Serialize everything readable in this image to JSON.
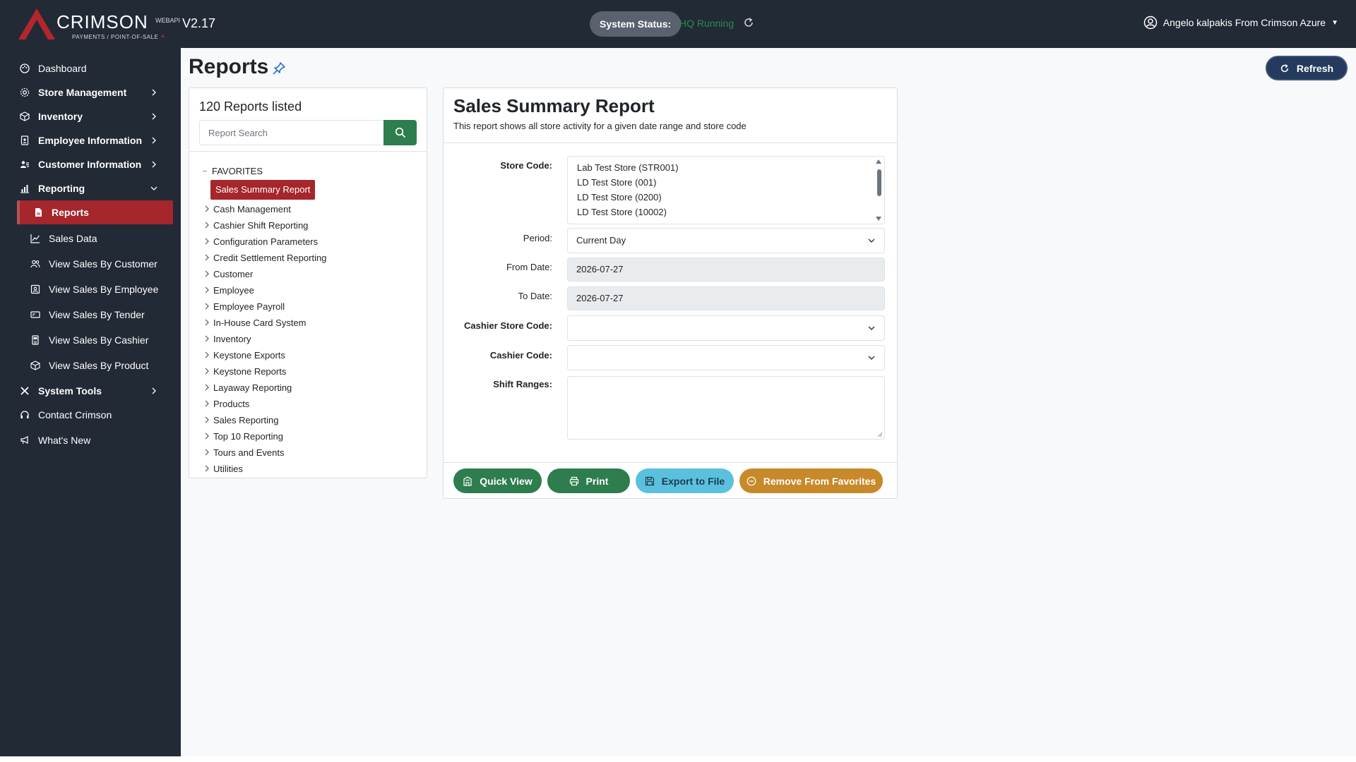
{
  "header": {
    "logo_word": "CRIMSON",
    "logo_tagline": "PAYMENTS / POINT-OF-SALE",
    "logo_plus": "+",
    "logo_badge": "WEBAPI",
    "version": "V2.17",
    "status_label": "System Status:",
    "status_value": "HQ Running",
    "user": "Angelo kalpakis  From Crimson Azure",
    "colors": {
      "bar": "#222a36",
      "status_ok": "#2c8a4f"
    }
  },
  "sidebar": {
    "items": [
      {
        "label": "Dashboard",
        "icon": "palette-icon"
      },
      {
        "label": "Store Management",
        "icon": "gear-icon"
      },
      {
        "label": "Inventory",
        "icon": "box-icon"
      },
      {
        "label": "Employee Information",
        "icon": "badge-icon"
      },
      {
        "label": "Customer Information",
        "icon": "users-icon"
      },
      {
        "label": "Reporting",
        "icon": "bar-chart-icon"
      },
      {
        "label": "Reports",
        "icon": "file-icon"
      },
      {
        "label": "Sales Data",
        "icon": "line-chart-icon"
      },
      {
        "label": "View Sales By Customer",
        "icon": "users-icon"
      },
      {
        "label": "View Sales By Employee",
        "icon": "badge-icon"
      },
      {
        "label": "View Sales By Tender",
        "icon": "card-icon"
      },
      {
        "label": "View Sales By Cashier",
        "icon": "register-icon"
      },
      {
        "label": "View Sales By Product",
        "icon": "box-icon"
      },
      {
        "label": "System Tools",
        "icon": "tools-icon"
      },
      {
        "label": "Contact Crimson",
        "icon": "headset-icon"
      },
      {
        "label": "What's New",
        "icon": "megaphone-icon"
      }
    ],
    "active_color": "#a5262b"
  },
  "main": {
    "title": "Reports",
    "refresh_label": "Refresh",
    "list": {
      "count_text": "120 Reports listed",
      "search_placeholder": "Report Search",
      "favorites_label": "FAVORITES",
      "favorite_item": "Sales Summary Report",
      "categories": [
        "Cash Management",
        "Cashier Shift Reporting",
        "Configuration Parameters",
        "Credit Settlement Reporting",
        "Customer",
        "Employee",
        "Employee Payroll",
        "In-House Card System",
        "Inventory",
        "Keystone Exports",
        "Keystone Reports",
        "Layaway Reporting",
        "Products",
        "Sales Reporting",
        "Top 10 Reporting",
        "Tours and Events",
        "Utilities"
      ]
    },
    "report": {
      "title": "Sales Summary Report",
      "description": "This report shows all store activity for a given date range and store code",
      "store_code_label": "Store Code:",
      "store_options": [
        "Lab Test Store (STR001)",
        "LD Test Store (001)",
        "LD Test Store (0200)",
        "LD Test Store (10002)"
      ],
      "period_label": "Period:",
      "period_value": "Current Day",
      "from_label": "From Date:",
      "from_value": "2026-07-27",
      "to_label": "To Date:",
      "to_value": "2026-07-27",
      "cashier_store_label": "Cashier Store Code:",
      "cashier_store_value": "",
      "cashier_code_label": "Cashier Code:",
      "cashier_code_value": "",
      "shift_label": "Shift Ranges:",
      "buttons": {
        "quick_view": "Quick View",
        "print": "Print",
        "export": "Export to File",
        "remove_fav": "Remove From Favorites"
      },
      "colors": {
        "green": "#2e7d4e",
        "info": "#5bc0de",
        "warning": "#c8892a"
      }
    }
  }
}
